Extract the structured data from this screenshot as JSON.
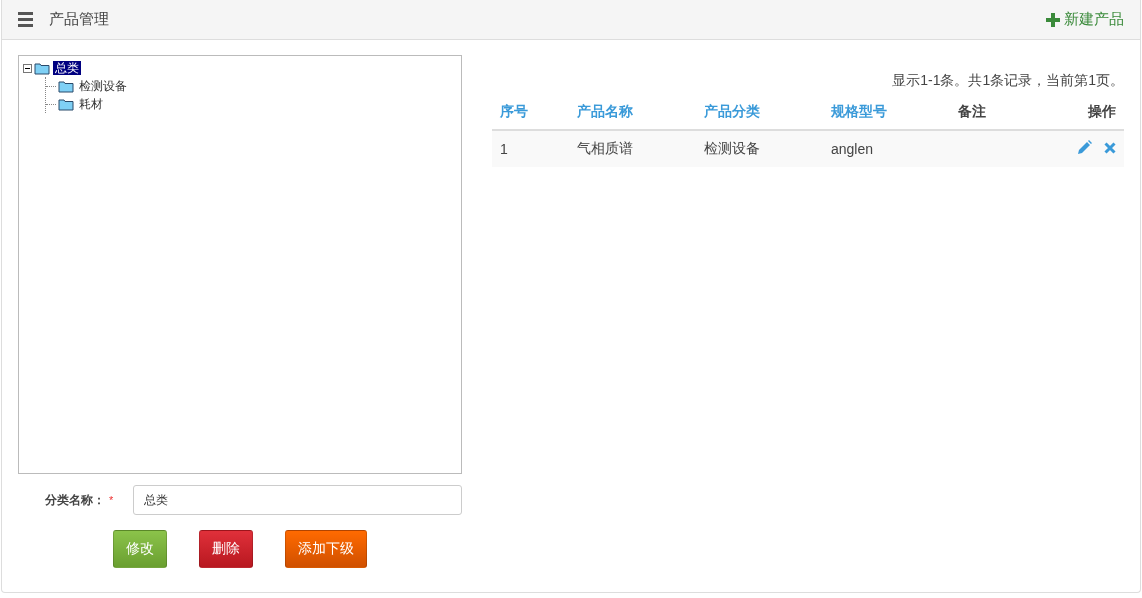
{
  "header": {
    "title": "产品管理",
    "action": "新建产品"
  },
  "tree": [
    {
      "label": "总类",
      "selected": true,
      "expanded": true,
      "children": [
        {
          "label": "检测设备",
          "selected": false
        },
        {
          "label": "耗材",
          "selected": false
        }
      ]
    }
  ],
  "form": {
    "label": "分类名称：",
    "required_mark": "*",
    "value": "总类"
  },
  "buttons": [
    {
      "label": "修改",
      "kind": "success"
    },
    {
      "label": "删除",
      "kind": "danger"
    },
    {
      "label": "添加下级",
      "kind": "warning"
    }
  ],
  "pager": "显示1-1条。共1条记录，当前第1页。",
  "table": {
    "columns": [
      {
        "label": "序号",
        "sortable": true
      },
      {
        "label": "产品名称",
        "sortable": true
      },
      {
        "label": "产品分类",
        "sortable": true
      },
      {
        "label": "规格型号",
        "sortable": true
      },
      {
        "label": "备注",
        "sortable": false
      },
      {
        "label": "操作",
        "sortable": false
      }
    ],
    "rows": [
      {
        "cells": [
          "1",
          "气相质谱",
          "检测设备",
          "anglen",
          ""
        ]
      }
    ]
  }
}
